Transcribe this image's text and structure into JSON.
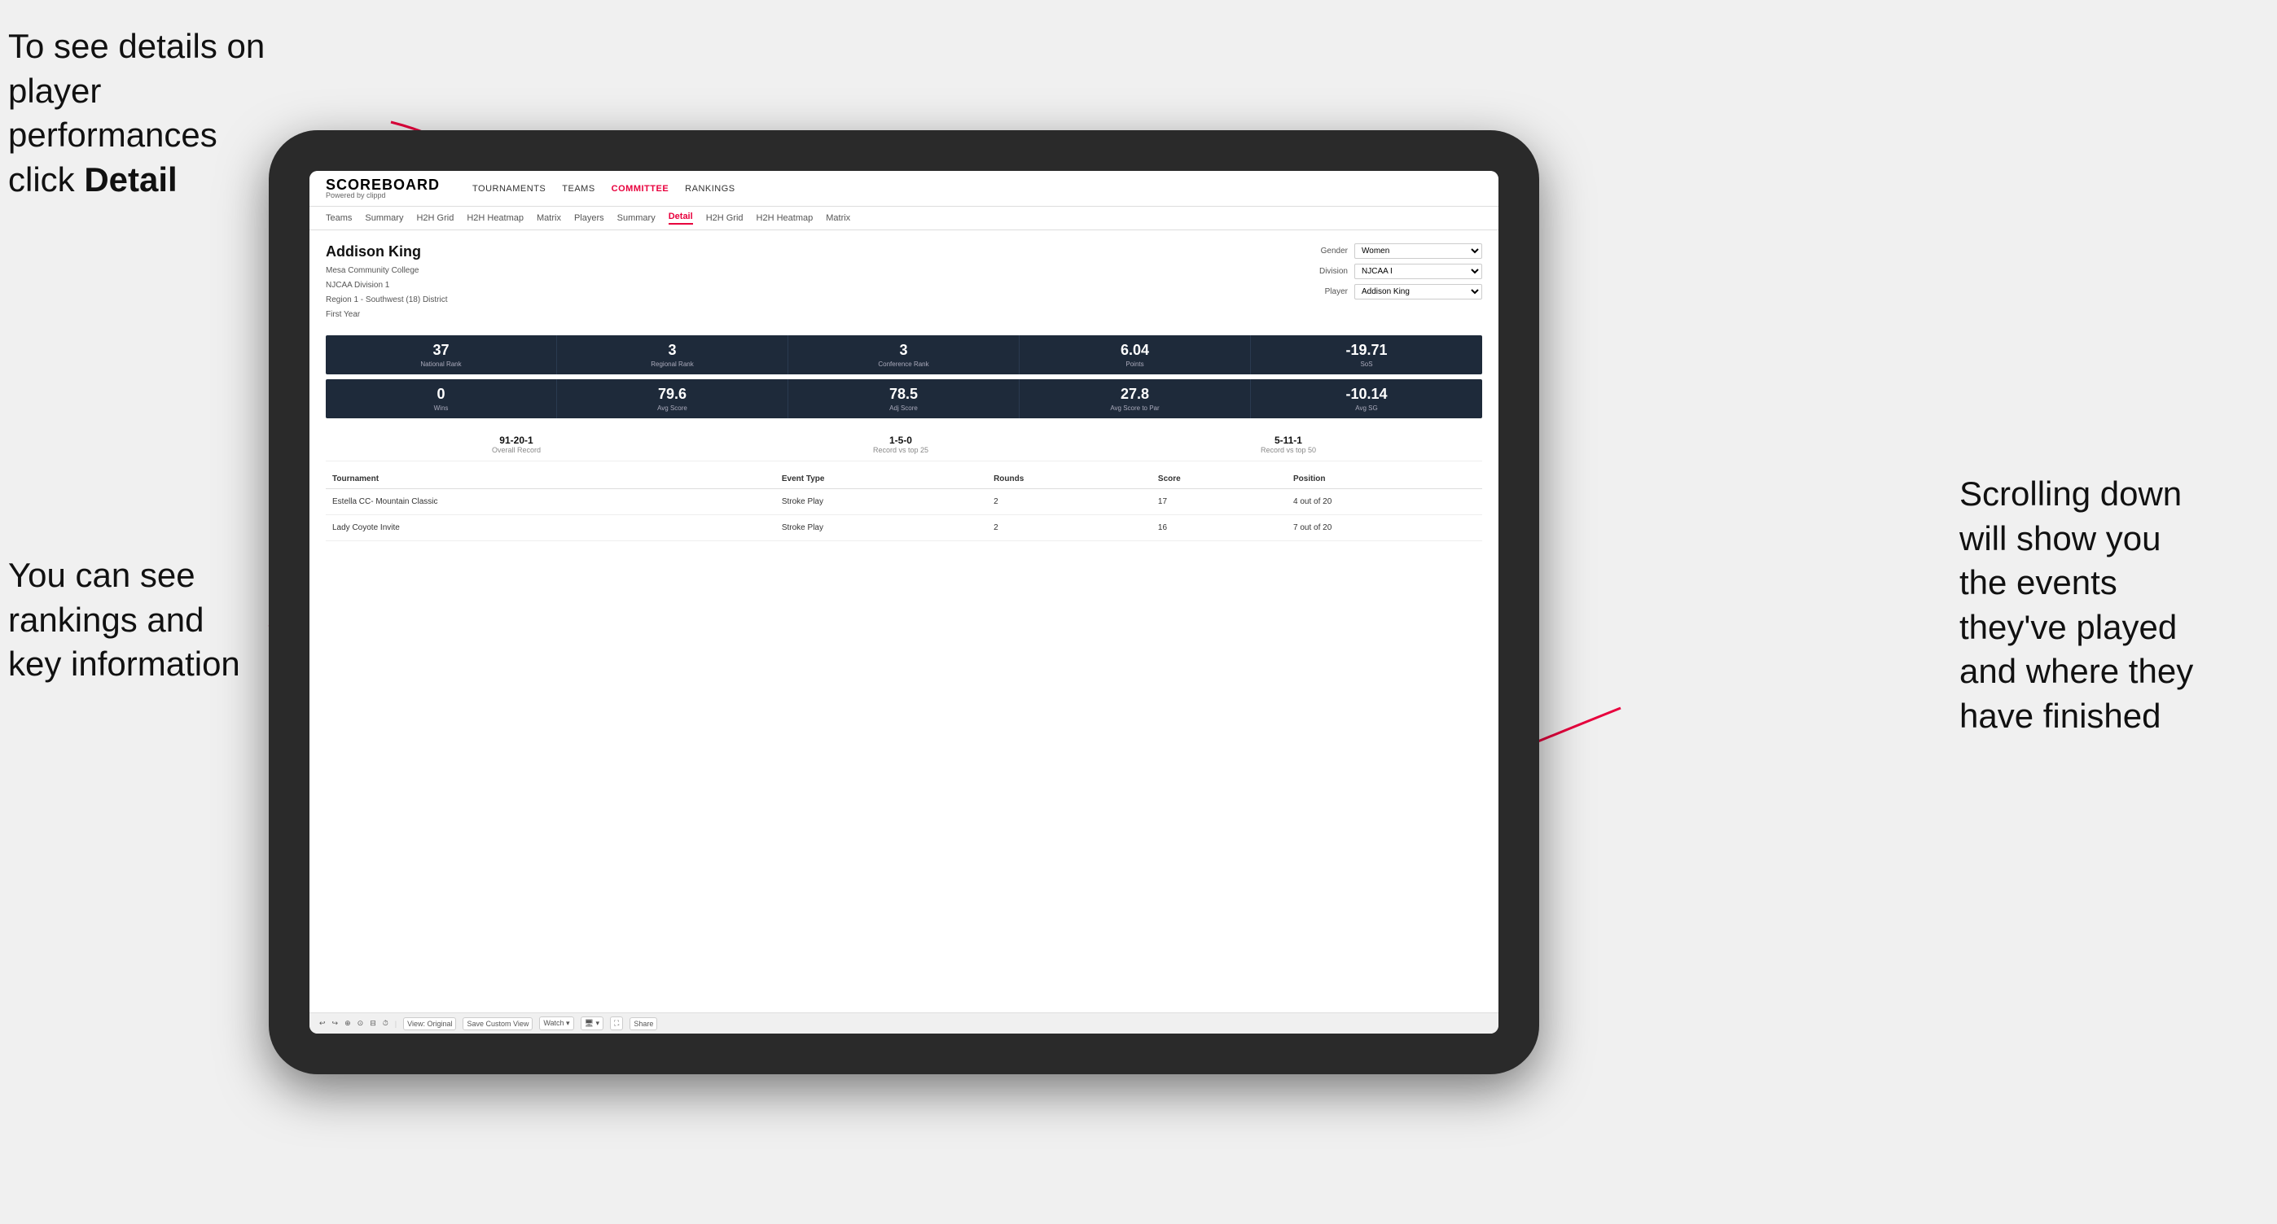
{
  "annotations": {
    "top_left": "To see details on player performances click ",
    "top_left_bold": "Detail",
    "bottom_left_line1": "You can see",
    "bottom_left_line2": "rankings and",
    "bottom_left_line3": "key information",
    "right_line1": "Scrolling down",
    "right_line2": "will show you",
    "right_line3": "the events",
    "right_line4": "they've played",
    "right_line5": "and where they",
    "right_line6": "have finished"
  },
  "app": {
    "logo_main": "SCOREBOARD",
    "logo_sub": "Powered by clippd"
  },
  "main_nav": {
    "items": [
      {
        "label": "TOURNAMENTS",
        "active": false
      },
      {
        "label": "TEAMS",
        "active": false
      },
      {
        "label": "COMMITTEE",
        "active": true
      },
      {
        "label": "RANKINGS",
        "active": false
      }
    ]
  },
  "sub_nav": {
    "items": [
      {
        "label": "Teams",
        "active": false
      },
      {
        "label": "Summary",
        "active": false
      },
      {
        "label": "H2H Grid",
        "active": false
      },
      {
        "label": "H2H Heatmap",
        "active": false
      },
      {
        "label": "Matrix",
        "active": false
      },
      {
        "label": "Players",
        "active": false
      },
      {
        "label": "Summary",
        "active": false
      },
      {
        "label": "Detail",
        "active": true
      },
      {
        "label": "H2H Grid",
        "active": false
      },
      {
        "label": "H2H Heatmap",
        "active": false
      },
      {
        "label": "Matrix",
        "active": false
      }
    ]
  },
  "player": {
    "name": "Addison King",
    "college": "Mesa Community College",
    "division": "NJCAA Division 1",
    "region": "Region 1 - Southwest (18) District",
    "year": "First Year"
  },
  "controls": {
    "gender_label": "Gender",
    "gender_value": "Women",
    "division_label": "Division",
    "division_value": "NJCAA I",
    "player_label": "Player",
    "player_value": "Addison King"
  },
  "stats_row1": [
    {
      "value": "37",
      "label": "National Rank"
    },
    {
      "value": "3",
      "label": "Regional Rank"
    },
    {
      "value": "3",
      "label": "Conference Rank"
    },
    {
      "value": "6.04",
      "label": "Points"
    },
    {
      "value": "-19.71",
      "label": "SoS"
    }
  ],
  "stats_row2": [
    {
      "value": "0",
      "label": "Wins"
    },
    {
      "value": "79.6",
      "label": "Avg Score"
    },
    {
      "value": "78.5",
      "label": "Adj Score"
    },
    {
      "value": "27.8",
      "label": "Avg Score to Par"
    },
    {
      "value": "-10.14",
      "label": "Avg SG"
    }
  ],
  "records": [
    {
      "value": "91-20-1",
      "label": "Overall Record"
    },
    {
      "value": "1-5-0",
      "label": "Record vs top 25"
    },
    {
      "value": "5-11-1",
      "label": "Record vs top 50"
    }
  ],
  "table": {
    "headers": [
      "Tournament",
      "Event Type",
      "Rounds",
      "Score",
      "Position"
    ],
    "rows": [
      {
        "tournament": "Estella CC- Mountain Classic",
        "event_type": "Stroke Play",
        "rounds": "2",
        "score": "17",
        "position": "4 out of 20"
      },
      {
        "tournament": "Lady Coyote Invite",
        "event_type": "Stroke Play",
        "rounds": "2",
        "score": "16",
        "position": "7 out of 20"
      }
    ]
  },
  "toolbar": {
    "items": [
      "↩",
      "↪",
      "⊕",
      "⊙",
      "⊟ ·",
      "⏱",
      "View: Original",
      "Save Custom View",
      "Watch ▾",
      "🖥 ▾",
      "⛶",
      "Share"
    ]
  }
}
